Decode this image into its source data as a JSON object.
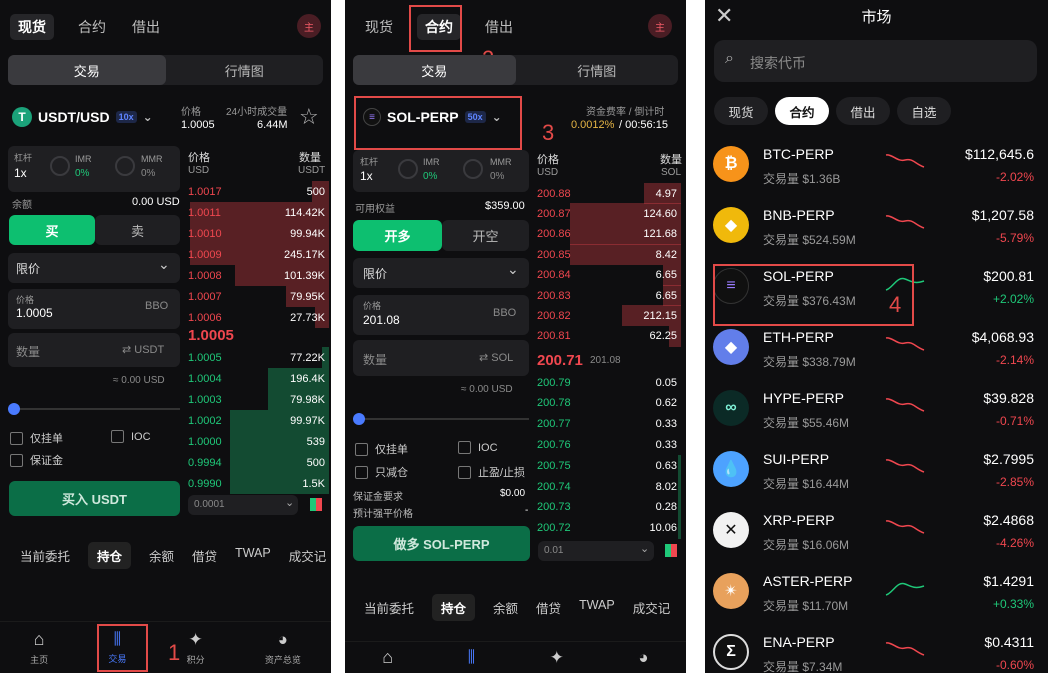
{
  "panel1": {
    "tabs": [
      "现货",
      "合约",
      "借出"
    ],
    "corner_badge": "主",
    "seg": [
      "交易",
      "行情图"
    ],
    "pair": "USDT/USD",
    "pair_badge": "10x",
    "price_label": "价格",
    "price_value": "1.0005",
    "vol_label": "24小时成交量",
    "vol_value": "6.44M",
    "leverage_label": "杠杆",
    "leverage_value": "1x",
    "imr_label": "IMR",
    "imr_value": "0%",
    "mmr_label": "MMR",
    "mmr_value": "0%",
    "balance_label": "余额",
    "balance_value": "0.00 USD",
    "buy": "买",
    "sell": "卖",
    "order_type": "限价",
    "price_input_label": "价格",
    "price_input_value": "1.0005",
    "bbo": "BBO",
    "qty_placeholder": "数量",
    "qty_unit": "⇄ USDT",
    "approx": "≈ 0.00 USD",
    "post_only": "仅挂单",
    "ioc": "IOC",
    "margin": "保证金",
    "buy_button": "买入 USDT",
    "ob_head_price": "价格",
    "ob_head_qty": "数量",
    "ob_unit_price": "USD",
    "ob_unit_qty": "USDT",
    "asks": [
      {
        "p": "1.0017",
        "q": "500",
        "w": 0.12
      },
      {
        "p": "1.0011",
        "q": "114.42K",
        "w": 0.96
      },
      {
        "p": "1.0010",
        "q": "99.94K",
        "w": 0.96
      },
      {
        "p": "1.0009",
        "q": "245.17K",
        "w": 0.96
      },
      {
        "p": "1.0008",
        "q": "101.39K",
        "w": 0.65
      },
      {
        "p": "1.0007",
        "q": "79.95K",
        "w": 0.3
      },
      {
        "p": "1.0006",
        "q": "27.73K",
        "w": 0.1
      }
    ],
    "mid": "1.0005",
    "bids": [
      {
        "p": "1.0005",
        "q": "77.22K",
        "w": 0.05
      },
      {
        "p": "1.0004",
        "q": "196.4K",
        "w": 0.42
      },
      {
        "p": "1.0003",
        "q": "79.98K",
        "w": 0.42
      },
      {
        "p": "1.0002",
        "q": "99.97K",
        "w": 0.68
      },
      {
        "p": "1.0000",
        "q": "539",
        "w": 0.68
      },
      {
        "p": "0.9994",
        "q": "500",
        "w": 0.68
      },
      {
        "p": "0.9990",
        "q": "1.5K",
        "w": 0.68
      }
    ],
    "tick": "0.0001",
    "bottom_tabs": [
      "当前委托",
      "持仓",
      "余额",
      "借贷",
      "TWAP",
      "成交记"
    ],
    "nav": [
      "主页",
      "交易",
      "积分",
      "资产总览"
    ],
    "step": "1"
  },
  "panel2": {
    "tabs": [
      "现货",
      "合约",
      "借出"
    ],
    "corner_badge": "主",
    "seg": [
      "交易",
      "行情图"
    ],
    "pair": "SOL-PERP",
    "pair_badge": "50x",
    "funding_label": "资金费率 / 倒计时",
    "funding_rate": "0.0012%",
    "funding_countdown": "/ 00:56:15",
    "leverage_label": "杠杆",
    "leverage_value": "1x",
    "imr_label": "IMR",
    "imr_value": "0%",
    "mmr_label": "MMR",
    "mmr_value": "0%",
    "equity_label": "可用权益",
    "equity_value": "$359.00",
    "long": "开多",
    "short": "开空",
    "order_type": "限价",
    "price_input_label": "价格",
    "price_input_value": "201.08",
    "bbo": "BBO",
    "qty_placeholder": "数量",
    "qty_unit": "⇄ SOL",
    "approx": "≈ 0.00 USD",
    "post_only": "仅挂单",
    "ioc": "IOC",
    "reduce_only": "只减仓",
    "tpsl": "止盈/止损",
    "margin_req_label": "保证金要求",
    "margin_req_value": "$0.00",
    "liq_label": "预计强平价格",
    "liq_value": "-",
    "long_button": "做多 SOL-PERP",
    "ob_head_price": "价格",
    "ob_head_qty": "数量",
    "ob_unit_price": "USD",
    "ob_unit_qty": "SOL",
    "asks": [
      {
        "p": "200.88",
        "q": "4.97",
        "w": 0.25
      },
      {
        "p": "200.87",
        "q": "124.60",
        "w": 0.75
      },
      {
        "p": "200.86",
        "q": "121.68",
        "w": 0.75
      },
      {
        "p": "200.85",
        "q": "8.42",
        "w": 0.75
      },
      {
        "p": "200.84",
        "q": "6.65",
        "w": 0.12
      },
      {
        "p": "200.83",
        "q": "6.65",
        "w": 0.12
      },
      {
        "p": "200.82",
        "q": "212.15",
        "w": 0.4
      },
      {
        "p": "200.81",
        "q": "62.25",
        "w": 0.08
      }
    ],
    "mid": "200.71",
    "mid_sub": "201.08",
    "bids": [
      {
        "p": "200.79",
        "q": "0.05",
        "w": 0
      },
      {
        "p": "200.78",
        "q": "0.62",
        "w": 0
      },
      {
        "p": "200.77",
        "q": "0.33",
        "w": 0
      },
      {
        "p": "200.76",
        "q": "0.33",
        "w": 0
      },
      {
        "p": "200.75",
        "q": "0.63",
        "w": 0.02
      },
      {
        "p": "200.74",
        "q": "8.02",
        "w": 0.02
      },
      {
        "p": "200.73",
        "q": "0.28",
        "w": 0.02
      },
      {
        "p": "200.72",
        "q": "10.06",
        "w": 0.02
      }
    ],
    "tick": "0.01",
    "bottom_tabs": [
      "当前委托",
      "持仓",
      "余额",
      "借贷",
      "TWAP",
      "成交记"
    ],
    "step_tab": "2",
    "step_pair": "3"
  },
  "panel3": {
    "title": "市场",
    "search_placeholder": "搜索代币",
    "filters": [
      "现货",
      "合约",
      "借出",
      "自选"
    ],
    "markets": [
      {
        "name": "BTC-PERP",
        "vol": "交易量 $1.36B",
        "price": "$112,645.6",
        "chg": "-2.02%",
        "up": false,
        "icon": "btc-icon",
        "color": "#f7931a",
        "glyph": "₿"
      },
      {
        "name": "BNB-PERP",
        "vol": "交易量 $524.59M",
        "price": "$1,207.58",
        "chg": "-5.79%",
        "up": false,
        "icon": "bnb-icon",
        "color": "#f0b90b",
        "glyph": "◆"
      },
      {
        "name": "SOL-PERP",
        "vol": "交易量 $376.43M",
        "price": "$200.81",
        "chg": "+2.02%",
        "up": true,
        "icon": "sol-icon",
        "color": "#101010",
        "glyph": "≡"
      },
      {
        "name": "ETH-PERP",
        "vol": "交易量 $338.79M",
        "price": "$4,068.93",
        "chg": "-2.14%",
        "up": false,
        "icon": "eth-icon",
        "color": "#627eea",
        "glyph": "◆"
      },
      {
        "name": "HYPE-PERP",
        "vol": "交易量 $55.46M",
        "price": "$39.828",
        "chg": "-0.71%",
        "up": false,
        "icon": "hype-icon",
        "color": "#0b2a26",
        "glyph": "∞"
      },
      {
        "name": "SUI-PERP",
        "vol": "交易量 $16.44M",
        "price": "$2.7995",
        "chg": "-2.85%",
        "up": false,
        "icon": "sui-icon",
        "color": "#4da2ff",
        "glyph": "💧"
      },
      {
        "name": "XRP-PERP",
        "vol": "交易量 $16.06M",
        "price": "$2.4868",
        "chg": "-4.26%",
        "up": false,
        "icon": "xrp-icon",
        "color": "#f2f2f2",
        "glyph": "✕"
      },
      {
        "name": "ASTER-PERP",
        "vol": "交易量 $11.70M",
        "price": "$1.4291",
        "chg": "+0.33%",
        "up": true,
        "icon": "aster-icon",
        "color": "#e8a15c",
        "glyph": "✴"
      },
      {
        "name": "ENA-PERP",
        "vol": "交易量 $7.34M",
        "price": "$0.4311",
        "chg": "-0.60%",
        "up": false,
        "icon": "ena-icon",
        "color": "#111",
        "glyph": "Σ"
      }
    ],
    "step": "4"
  },
  "colors": {
    "green": "#1fc879",
    "red": "#f0474f",
    "accent_blue": "#4a7bff",
    "highlight": "#e24a48"
  }
}
